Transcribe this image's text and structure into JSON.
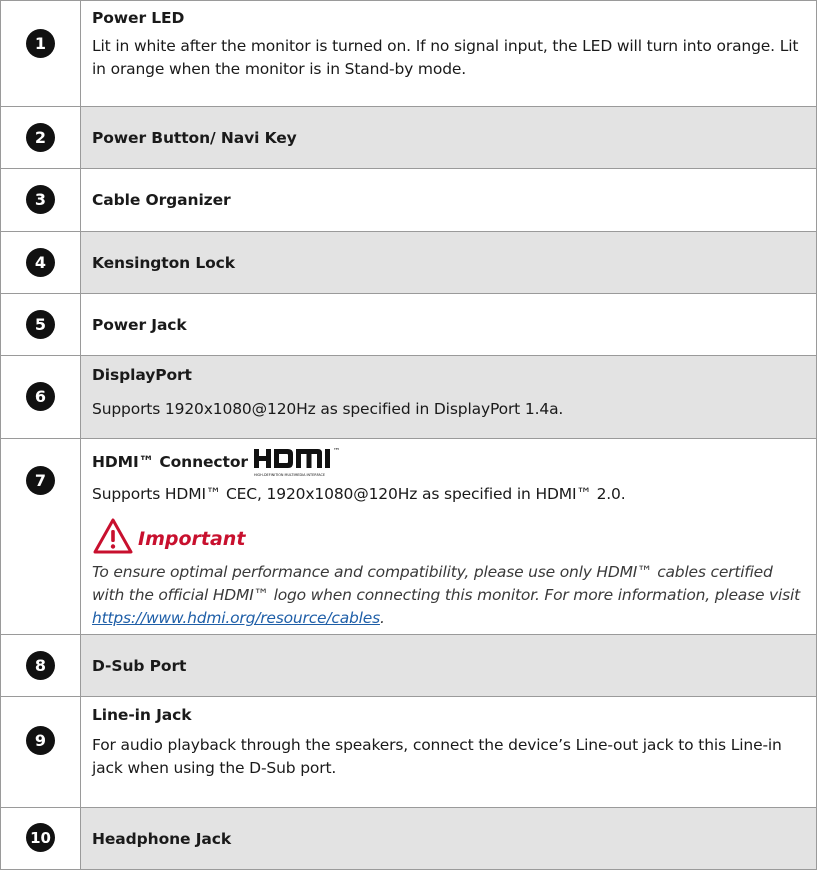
{
  "rows": [
    {
      "num": "1",
      "title": "Power LED",
      "desc": "Lit in white after the monitor is turned on. If no signal input, the LED will turn into orange. Lit in orange when the monitor is in Stand-by mode."
    },
    {
      "num": "2",
      "title": "Power Button/ Navi Key"
    },
    {
      "num": "3",
      "title": "Cable Organizer"
    },
    {
      "num": "4",
      "title": "Kensington Lock"
    },
    {
      "num": "5",
      "title": "Power Jack"
    },
    {
      "num": "6",
      "title": "DisplayPort",
      "desc": "Supports 1920x1080@120Hz as specified in DisplayPort 1.4a."
    },
    {
      "num": "7",
      "title": "HDMI™ Connector",
      "logo_text": "HDMI",
      "logo_tm": "™",
      "logo_subtitle": "HIGH-DEFINITION MULTIMEDIA INTERFACE",
      "desc": "Supports HDMI™ CEC, 1920x1080@120Hz as specified in HDMI™ 2.0.",
      "important_title": "Important",
      "important_text": "To ensure optimal performance and compatibility, please use only HDMI™ cables certified with the official HDMI™ logo when connecting this monitor. For more information, please visit ",
      "important_link": "https://www.hdmi.org/resource/cables",
      "important_end": "."
    },
    {
      "num": "8",
      "title": "D-Sub Port"
    },
    {
      "num": "9",
      "title": "Line-in Jack",
      "desc": "For audio playback through the speakers, connect the device’s Line-out jack to this Line-in jack when using the D-Sub port."
    },
    {
      "num": "10",
      "title": "Headphone Jack"
    }
  ],
  "colors": {
    "grey_row": "#e3e3e3",
    "important_red": "#c8102e",
    "link_blue": "#1f5fa8"
  },
  "icons": {
    "warning": "warning-triangle-icon",
    "hdmi": "hdmi-logo"
  }
}
